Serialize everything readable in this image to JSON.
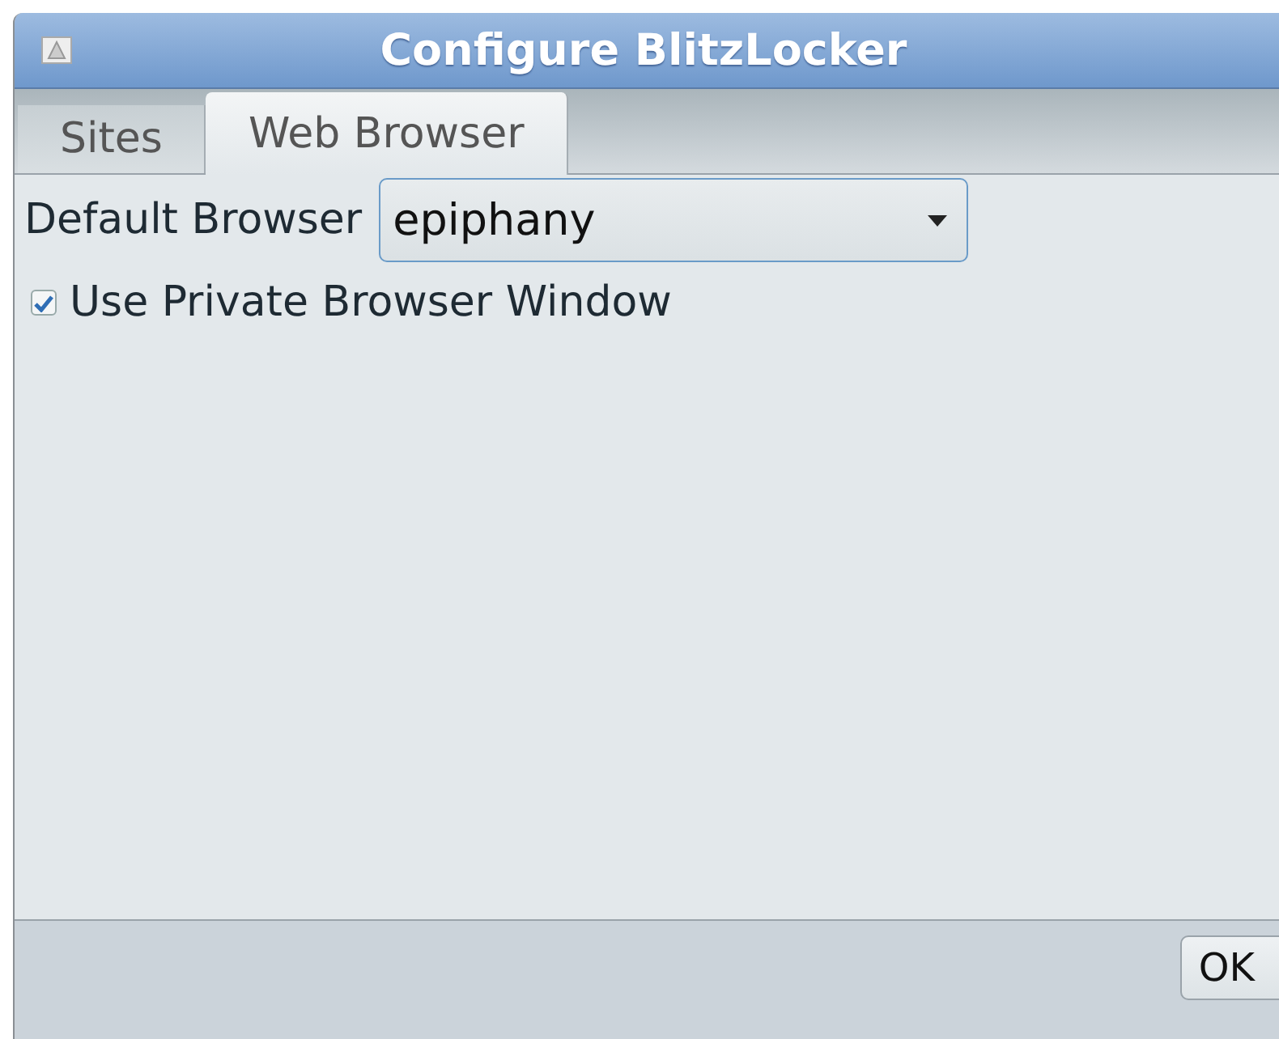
{
  "window": {
    "title": "Configure BlitzLocker"
  },
  "tabs": [
    {
      "label": "Sites",
      "selected": false
    },
    {
      "label": "Web Browser",
      "selected": true
    }
  ],
  "default_browser": {
    "label": "Default Browser",
    "value": "epiphany"
  },
  "private_window": {
    "label": "Use Private Browser Window",
    "checked": true
  },
  "buttons": [
    "OK"
  ]
}
